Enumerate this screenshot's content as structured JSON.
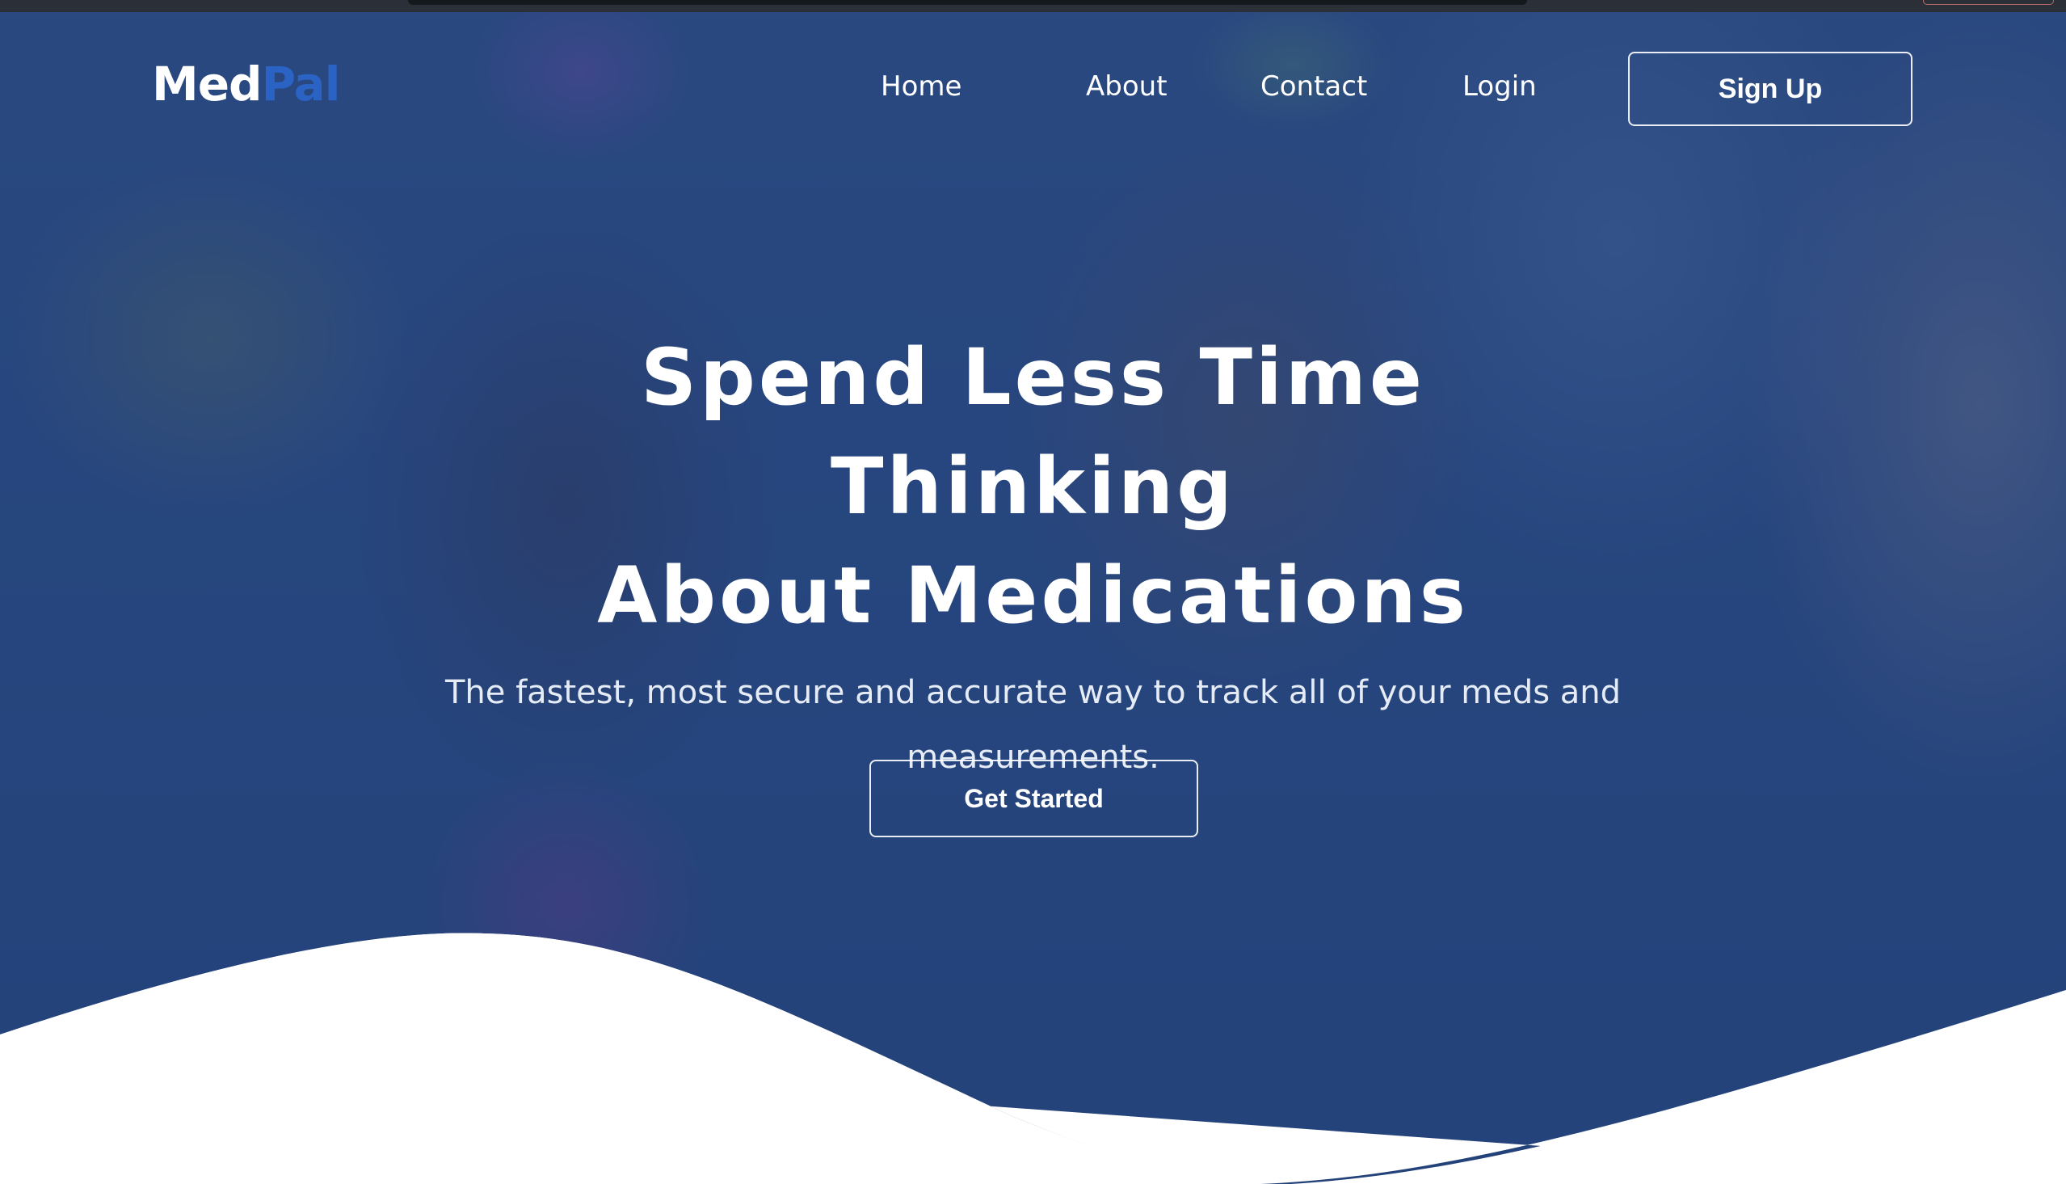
{
  "brand": {
    "name_part1": "Med",
    "name_part2": "Pal",
    "accent_color": "#2a63c4"
  },
  "nav": {
    "items": [
      {
        "label": "Home"
      },
      {
        "label": "About"
      },
      {
        "label": "Contact"
      },
      {
        "label": "Login"
      }
    ],
    "signup_label": "Sign Up"
  },
  "hero": {
    "headline_line1": "Spend Less Time Thinking",
    "headline_line2": "About Medications",
    "subtitle": "The fastest, most secure and accurate way to track all of your meds and measurements.",
    "cta_label": "Get Started",
    "overlay_color": "#1c3a78",
    "wave_color": "#ffffff"
  }
}
